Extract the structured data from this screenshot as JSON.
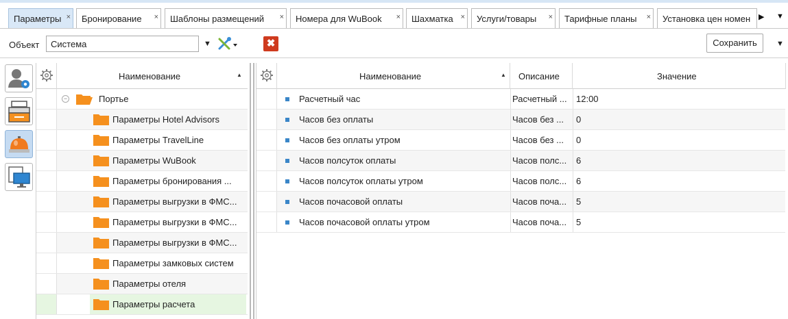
{
  "tabs": [
    {
      "label": "Параметры",
      "close": "×",
      "active": true
    },
    {
      "label": "Бронирование",
      "close": "×"
    },
    {
      "label": "Шаблоны размещений",
      "close": "×"
    },
    {
      "label": "Номера для WuBook",
      "close": "×"
    },
    {
      "label": "Шахматка",
      "close": "×"
    },
    {
      "label": "Услуги/товары",
      "close": "×"
    },
    {
      "label": "Тарифные планы",
      "close": "×"
    },
    {
      "label": "Установка цен номен",
      "close": ""
    }
  ],
  "tab_scroll_glyph": "▶",
  "tab_more_glyph": "▼",
  "toolbar": {
    "object_label": "Объект",
    "object_value": "Система",
    "dropdown_glyph": "▼",
    "delete_glyph": "✖",
    "save_label": "Сохранить",
    "more_glyph": "▼"
  },
  "side_icons": [
    "user-settings-icon",
    "cash-register-icon",
    "reception-bell-icon",
    "monitor-icon"
  ],
  "tree": {
    "header": "Наименование",
    "sort_glyph": "▲",
    "root": {
      "label": "Портье",
      "expander": "−"
    },
    "items": [
      {
        "label": "Параметры Hotel Advisors"
      },
      {
        "label": "Параметры TravelLine"
      },
      {
        "label": "Параметры WuBook"
      },
      {
        "label": "Параметры бронирования ..."
      },
      {
        "label": "Параметры выгрузки в ФМС..."
      },
      {
        "label": "Параметры выгрузки в ФМС..."
      },
      {
        "label": "Параметры выгрузки в ФМС..."
      },
      {
        "label": "Параметры замковых систем"
      },
      {
        "label": "Параметры отеля"
      },
      {
        "label": "Параметры расчета",
        "selected": true
      }
    ]
  },
  "grid": {
    "columns": {
      "name": "Наименование",
      "description": "Описание",
      "value": "Значение"
    },
    "sort_glyph": "▲",
    "rows": [
      {
        "name": "Расчетный час",
        "description": "Расчетный ...",
        "value": "12:00"
      },
      {
        "name": "Часов без оплаты",
        "description": "Часов без ...",
        "value": "0"
      },
      {
        "name": "Часов без оплаты утром",
        "description": "Часов без ...",
        "value": "0"
      },
      {
        "name": "Часов полсуток оплаты",
        "description": "Часов полс...",
        "value": "6"
      },
      {
        "name": "Часов полсуток оплаты утром",
        "description": "Часов полс...",
        "value": "6"
      },
      {
        "name": "Часов почасовой оплаты",
        "description": "Часов поча...",
        "value": "5"
      },
      {
        "name": "Часов почасовой оплаты утром",
        "description": "Часов поча...",
        "value": "5"
      }
    ]
  },
  "colors": {
    "active_tab": "#d9e8f7",
    "folder": "#f5901e",
    "selected_row": "#e6f6e1",
    "bullet": "#3a86c8",
    "delete": "#cf3b1f"
  }
}
